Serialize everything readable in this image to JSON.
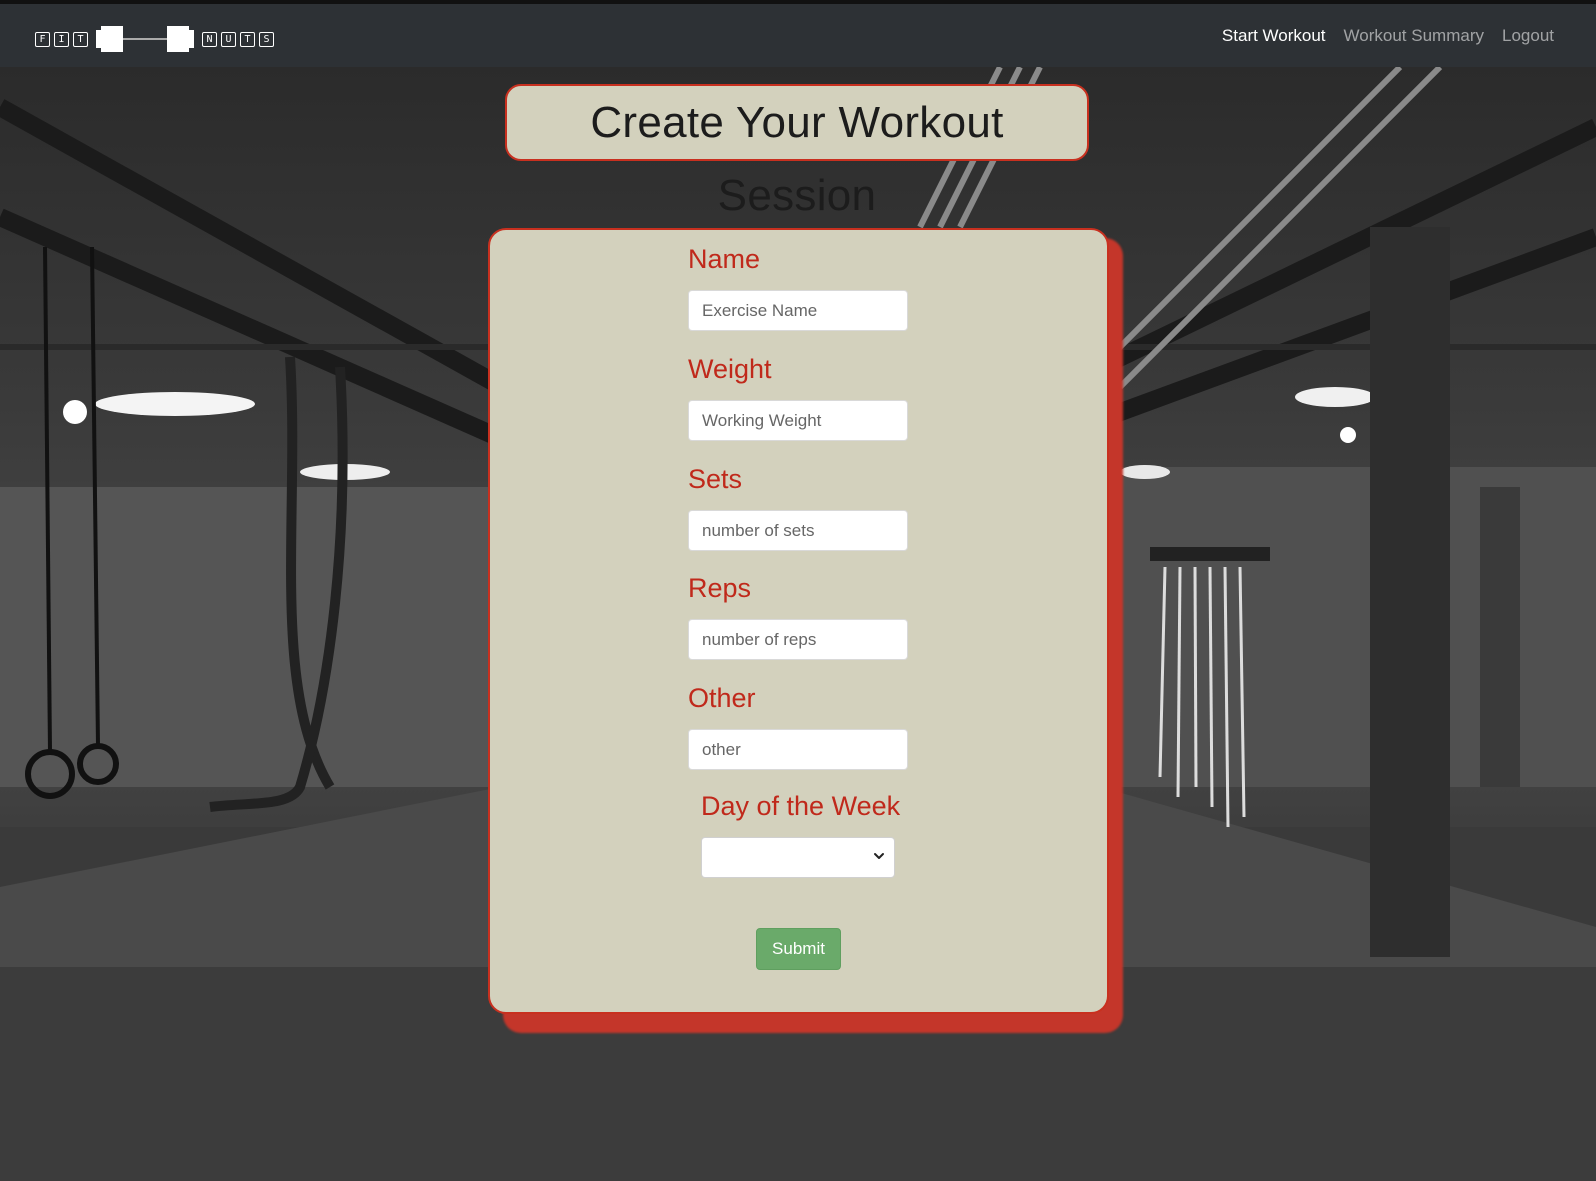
{
  "navbar": {
    "brand_letters_left": [
      "F",
      "I",
      "T"
    ],
    "brand_letters_right": [
      "N",
      "U",
      "T",
      "S"
    ],
    "links": [
      {
        "label": "Start Workout",
        "active": true
      },
      {
        "label": "Workout Summary",
        "active": false
      },
      {
        "label": "Logout",
        "active": false
      }
    ]
  },
  "page": {
    "title": "Create Your Workout Session"
  },
  "form": {
    "fields": [
      {
        "label": "Name",
        "placeholder": "Exercise Name",
        "value": ""
      },
      {
        "label": "Weight",
        "placeholder": "Working Weight",
        "value": ""
      },
      {
        "label": "Sets",
        "placeholder": "number of sets",
        "value": ""
      },
      {
        "label": "Reps",
        "placeholder": "number of reps",
        "value": ""
      },
      {
        "label": "Other",
        "placeholder": "other",
        "value": ""
      }
    ],
    "day_label": "Day of the Week",
    "day_selected": "",
    "submit_label": "Submit"
  },
  "colors": {
    "navbar_bg": "#2d3135",
    "card_bg": "#d3d1bd",
    "accent_red": "#c8301f",
    "submit_green": "#6aaa6a"
  },
  "icons": {
    "brand": "barbell-logo",
    "select_chevron": "chevron-down-icon"
  }
}
